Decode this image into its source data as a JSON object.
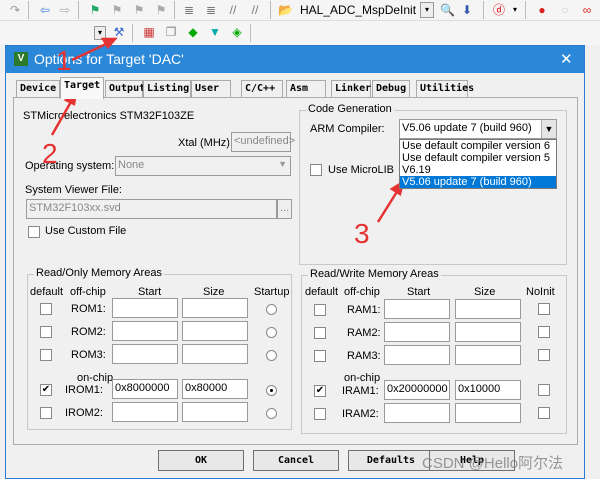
{
  "toolbar": {
    "function_combo": "HAL_ADC_MspDeInit"
  },
  "dialog": {
    "title": "Options for Target 'DAC'",
    "close": "✕"
  },
  "tabs": [
    "Device",
    "Target",
    "Output",
    "Listing",
    "User",
    "C/C++",
    "Asm",
    "Linker",
    "Debug",
    "Utilities"
  ],
  "target": {
    "device": "STMicroelectronics STM32F103ZE",
    "xtal_label": "Xtal (MHz):",
    "xtal_value": "<undefined>",
    "os_label": "Operating system:",
    "os_value": "None",
    "svf_label": "System Viewer File:",
    "svf_value": "STM32F103xx.svd",
    "browse": "...",
    "custom_file": "Use Custom File"
  },
  "codegen": {
    "title": "Code Generation",
    "compiler_label": "ARM Compiler:",
    "compiler_value": "V5.06 update 7 (build 960)",
    "options": [
      "Use default compiler version 6",
      "Use default compiler version 5",
      "V6.19",
      "V5.06 update 7 (build 960)"
    ],
    "microlib": "Use MicroLIB"
  },
  "rom": {
    "title": "Read/Only Memory Areas",
    "headers": [
      "default",
      "off-chip",
      "Start",
      "Size",
      "Startup"
    ],
    "onchip": "on-chip",
    "rows": [
      {
        "label": "ROM1:",
        "start": "",
        "size": "",
        "checked": false,
        "startup": false
      },
      {
        "label": "ROM2:",
        "start": "",
        "size": "",
        "checked": false,
        "startup": false
      },
      {
        "label": "ROM3:",
        "start": "",
        "size": "",
        "checked": false,
        "startup": false
      },
      {
        "label": "IROM1:",
        "start": "0x8000000",
        "size": "0x80000",
        "checked": true,
        "startup": true
      },
      {
        "label": "IROM2:",
        "start": "",
        "size": "",
        "checked": false,
        "startup": false
      }
    ]
  },
  "ram": {
    "title": "Read/Write Memory Areas",
    "headers": [
      "default",
      "off-chip",
      "Start",
      "Size",
      "NoInit"
    ],
    "onchip": "on-chip",
    "rows": [
      {
        "label": "RAM1:",
        "start": "",
        "size": "",
        "checked": false
      },
      {
        "label": "RAM2:",
        "start": "",
        "size": "",
        "checked": false
      },
      {
        "label": "RAM3:",
        "start": "",
        "size": "",
        "checked": false
      },
      {
        "label": "IRAM1:",
        "start": "0x20000000",
        "size": "0x10000",
        "checked": true
      },
      {
        "label": "IRAM2:",
        "start": "",
        "size": "",
        "checked": false
      }
    ]
  },
  "buttons": [
    "OK",
    "Cancel",
    "Defaults",
    "Help"
  ],
  "annotations": [
    "1",
    "2",
    "3"
  ],
  "watermark": "CSDN @Hello阿尔法"
}
